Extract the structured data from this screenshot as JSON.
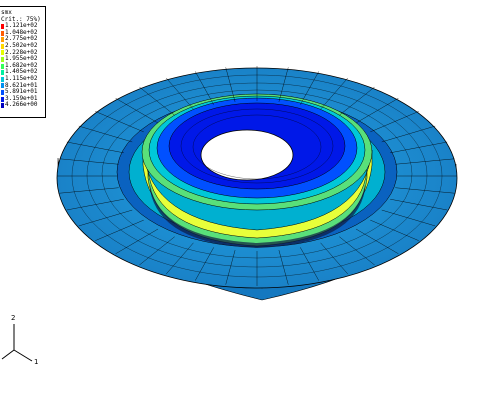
{
  "legend": {
    "title": "smx",
    "subtitle": "Crit.: 75%)",
    "entries": [
      {
        "value": "1.121e+02",
        "color": "#ff0000"
      },
      {
        "value": "1.048e+02",
        "color": "#ff5a00"
      },
      {
        "value": "2.775e+02",
        "color": "#ff9f00"
      },
      {
        "value": "2.502e+02",
        "color": "#ffd800"
      },
      {
        "value": "2.228e+02",
        "color": "#e6ff00"
      },
      {
        "value": "1.955e+02",
        "color": "#9cff1c"
      },
      {
        "value": "1.682e+02",
        "color": "#34ff5a"
      },
      {
        "value": "1.405e+02",
        "color": "#00f0a0"
      },
      {
        "value": "1.115e+02",
        "color": "#00c8d8"
      },
      {
        "value": "8.621e+01",
        "color": "#0090f0"
      },
      {
        "value": "5.891e+01",
        "color": "#0050ff"
      },
      {
        "value": "3.159e+01",
        "color": "#0018e8"
      },
      {
        "value": "4.266e+00",
        "color": "#0000c0"
      }
    ]
  },
  "triad": {
    "axis_2": "2",
    "axis_1": "1"
  },
  "colors": {
    "outer_ring": "#1e8fd0",
    "outer_ring_dark": "#0a5aa8",
    "mid_band": "#00b7c8",
    "green_band": "#59e07a",
    "yellow_band": "#e8ff3a",
    "inner_blue": "#0018e8",
    "deep_blue": "#0000b8"
  }
}
